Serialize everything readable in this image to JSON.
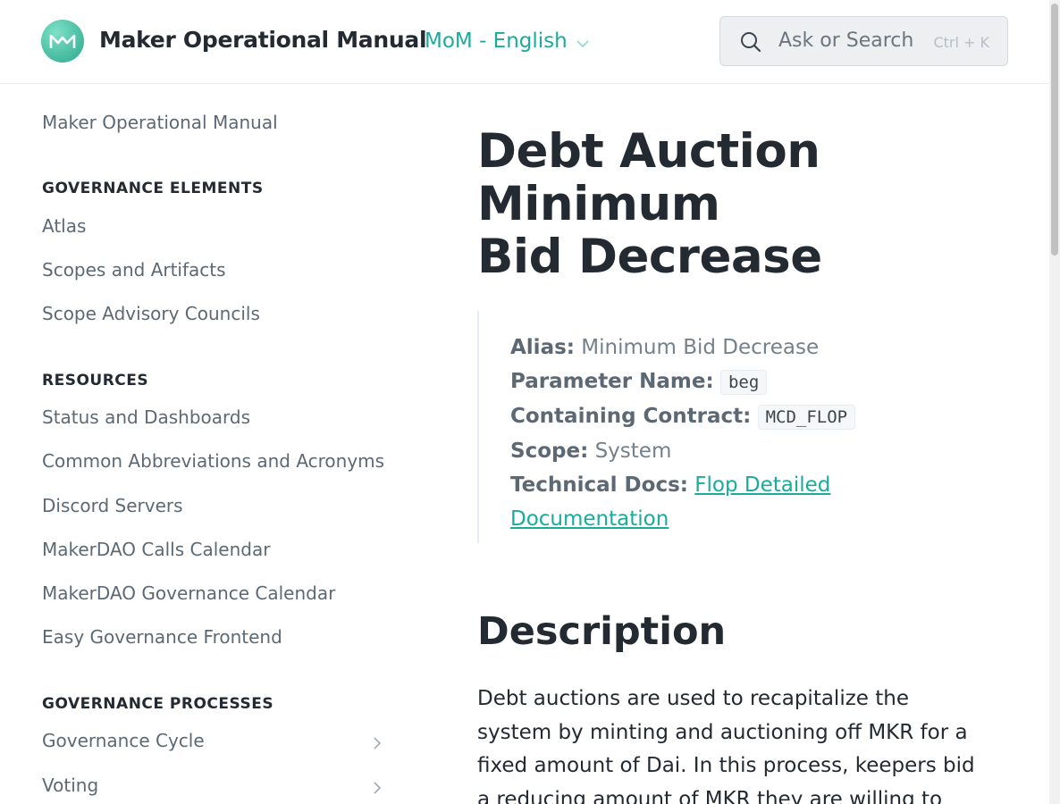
{
  "header": {
    "brand": "Maker Operational Manual",
    "space_switcher": "MoM - English",
    "search_placeholder": "Ask or Search",
    "search_shortcut": "Ctrl + K"
  },
  "sidebar": {
    "top_link": "Maker Operational Manual",
    "sections": [
      {
        "heading": "GOVERNANCE ELEMENTS",
        "items": [
          "Atlas",
          "Scopes and Artifacts",
          "Scope Advisory Councils"
        ]
      },
      {
        "heading": "RESOURCES",
        "items": [
          "Status and Dashboards",
          "Common Abbreviations and Acronyms",
          "Discord Servers",
          "MakerDAO Calls Calendar",
          "MakerDAO Governance Calendar",
          "Easy Governance Frontend"
        ]
      },
      {
        "heading": "GOVERNANCE PROCESSES",
        "items": [
          "Governance Cycle",
          "Voting"
        ]
      }
    ]
  },
  "page": {
    "title_lines": [
      "Debt Auction",
      "Minimum",
      "Bid Decrease"
    ],
    "meta": {
      "alias_label": "Alias:",
      "alias_value": "Minimum Bid Decrease",
      "param_label": "Parameter Name:",
      "param_value": "beg",
      "contract_label": "Containing Contract:",
      "contract_value": "MCD_FLOP",
      "scope_label": "Scope:",
      "scope_value": "System",
      "docs_label": "Technical Docs:",
      "docs_link_line1": "Flop Detailed ",
      "docs_link_line2": "Documentation"
    },
    "description_heading": "Description",
    "description_lines": [
      "Debt auctions are used to recapitalize the",
      "system by minting and auctioning off MKR for a",
      "fixed amount of Dai. In this process, keepers bid",
      "a reducing amount of MKR they are willing to"
    ]
  },
  "colors": {
    "accent": "#1aab9b",
    "text": "#242a31",
    "muted": "#5c6975"
  },
  "icons": [
    "maker-logo",
    "chevron-down-icon",
    "search-icon",
    "chevron-right-icon"
  ]
}
